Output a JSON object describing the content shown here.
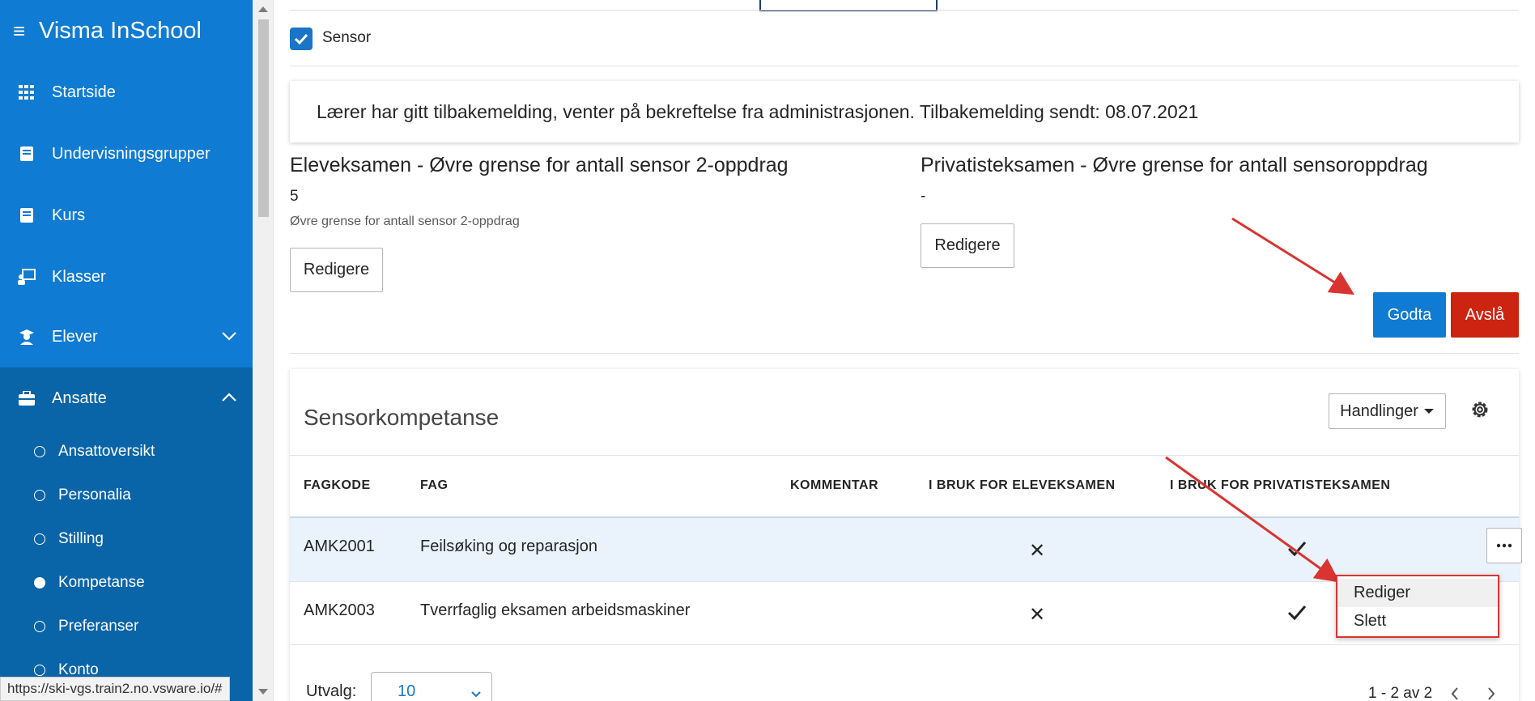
{
  "app": {
    "title": "Visma InSchool"
  },
  "sidebar": {
    "items": [
      {
        "label": "Startside"
      },
      {
        "label": "Undervisningsgrupper"
      },
      {
        "label": "Kurs"
      },
      {
        "label": "Klasser"
      },
      {
        "label": "Elever"
      },
      {
        "label": "Ansatte"
      }
    ],
    "subitems": [
      {
        "label": "Ansattoversikt"
      },
      {
        "label": "Personalia"
      },
      {
        "label": "Stilling"
      },
      {
        "label": "Kompetanse"
      },
      {
        "label": "Preferanser"
      },
      {
        "label": "Konto"
      }
    ]
  },
  "sensor": {
    "checkbox_label": "Sensor",
    "checked": true
  },
  "info": {
    "message": "Lærer har gitt tilbakemelding, venter på bekreftelse fra administrasjonen. Tilbakemelding sendt: 08.07.2021"
  },
  "eleveksamen": {
    "title": "Eleveksamen - Øvre grense for antall sensor 2-oppdrag",
    "value": "5",
    "help": "Øvre grense for antall sensor 2-oppdrag",
    "edit_label": "Redigere"
  },
  "privatisteksamen": {
    "title": "Privatisteksamen - Øvre grense for antall sensoroppdrag",
    "value": "-",
    "edit_label": "Redigere"
  },
  "actions": {
    "accept_label": "Godta",
    "reject_label": "Avslå"
  },
  "competence": {
    "title": "Sensorkompetanse",
    "handlinger_label": "Handlinger",
    "columns": [
      "FAGKODE",
      "FAG",
      "KOMMENTAR",
      "I BRUK FOR ELEVEKSAMEN",
      "I BRUK FOR PRIVATISTEKSAMEN"
    ],
    "rows": [
      {
        "code": "AMK2001",
        "subject": "Feilsøking og reparasjon",
        "comment": "",
        "elev": "✕",
        "privat": "✓"
      },
      {
        "code": "AMK2003",
        "subject": "Tverrfaglig eksamen arbeidsmaskiner",
        "comment": "",
        "elev": "✕",
        "privat": "✓"
      }
    ],
    "menu": {
      "edit": "Rediger",
      "delete": "Slett"
    }
  },
  "footer": {
    "utval_label": "Utvalg:",
    "utval_value": "10",
    "pager_text": "1 - 2 av 2"
  },
  "status_url": "https://ski-vgs.train2.no.vsware.io/#",
  "colors": {
    "primary": "#0f7bd2",
    "sidebar_dark": "#0964a8",
    "reject": "#cc2411",
    "annotation": "#d93430"
  }
}
